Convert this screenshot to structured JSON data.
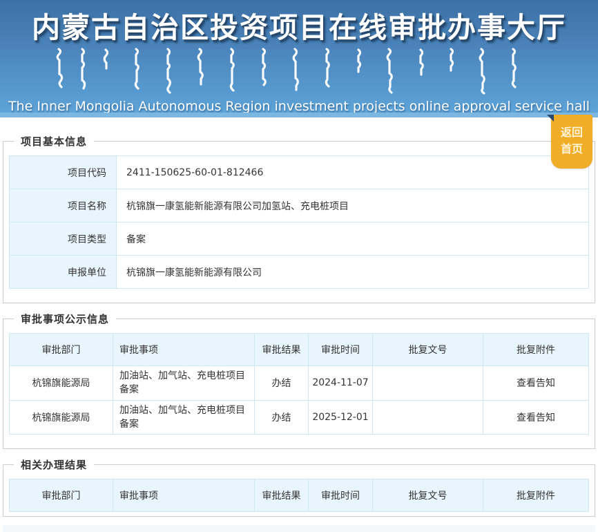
{
  "header": {
    "title_zh": "内蒙古自治区投资项目在线审批办事大厅",
    "subtitle_en": "The Inner Mongolia Autonomous Region investment projects online approval service hall"
  },
  "ribbon": {
    "line1": "返回",
    "line2": "首页"
  },
  "basic_info": {
    "section_title": "项目基本信息",
    "rows": [
      {
        "label": "项目代码",
        "value": "2411-150625-60-01-812466"
      },
      {
        "label": "项目名称",
        "value": "杭锦旗一康氢能新能源有限公司加氢站、充电桩项目"
      },
      {
        "label": "项目类型",
        "value": "备案"
      },
      {
        "label": "申报单位",
        "value": "杭锦旗一康氢能新能源有限公司"
      }
    ]
  },
  "approval_public": {
    "section_title": "审批事项公示信息",
    "headers": [
      "审批部门",
      "审批事项",
      "审批结果",
      "审批时间",
      "批复文号",
      "批复附件"
    ],
    "rows": [
      {
        "dept": "杭锦旗能源局",
        "item": "加油站、加气站、充电桩项目备案",
        "result": "办结",
        "date": "2024-11-07",
        "doc_no": "",
        "attachment": "查看告知"
      },
      {
        "dept": "杭锦旗能源局",
        "item": "加油站、加气站、充电桩项目备案",
        "result": "办结",
        "date": "2025-12-01",
        "doc_no": "",
        "attachment": "查看告知"
      }
    ]
  },
  "related_results": {
    "section_title": "相关办理结果",
    "headers": [
      "审批部门",
      "审批事项",
      "审批结果",
      "审批时间",
      "批复文号",
      "批复附件"
    ],
    "rows": []
  },
  "colors": {
    "header_gradient_top": "#3c70a5",
    "header_gradient_bottom": "#63a9dc",
    "header_bottom_strip": "#7cb7e2",
    "ribbon_orange": "#f0ad27",
    "table_border": "#cfe7f2",
    "cell_blue_bg": "#e8f5fc",
    "section_border": "#cccccc",
    "text": "#333333"
  }
}
